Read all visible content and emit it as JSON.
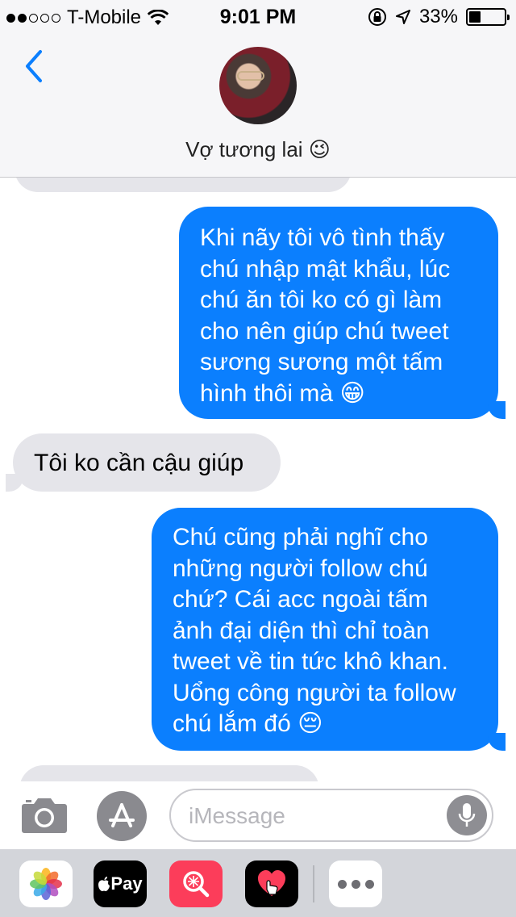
{
  "status_bar": {
    "carrier": "T-Mobile",
    "time": "9:01 PM",
    "battery": "33%",
    "battery_level": 0.33,
    "signal_bars": 2,
    "icons": [
      "wifi-icon",
      "rotation-lock-icon",
      "location-icon",
      "battery-icon"
    ]
  },
  "header": {
    "contact_name": "Vợ tương lai 😉",
    "back_icon": "chevron-left-icon",
    "accent_color": "#0b7ffe"
  },
  "messages": [
    {
      "direction": "incoming",
      "text": ""
    },
    {
      "direction": "outgoing",
      "lines": [
        "Khi nãy tôi vô tình thấy",
        "chú nhập mật khẩu, lúc",
        "chú ăn tôi ko có gì làm",
        "cho nên giúp chú tweet",
        "sương sương một tấm",
        "hình thôi mà 😁"
      ]
    },
    {
      "direction": "incoming",
      "text": "Tôi ko cần cậu giúp"
    },
    {
      "direction": "outgoing",
      "lines": [
        "Chú cũng phải nghĩ cho",
        "những người follow chú",
        "chứ? Cái acc ngoài tấm",
        "ảnh đại diện thì chỉ toàn",
        "tweet về tin tức khô khan.",
        "Uổng công người ta follow",
        "chú lắm đó 😔"
      ]
    },
    {
      "direction": "incoming",
      "text": ""
    }
  ],
  "input_bar": {
    "placeholder": "iMessage",
    "value": "",
    "icons": [
      "camera-icon",
      "app-store-icon",
      "microphone-icon"
    ]
  },
  "app_drawer": {
    "apps": [
      "photos-icon",
      "apple-pay-icon",
      "search-images-icon",
      "digital-touch-icon",
      "more-icon"
    ],
    "apple_pay_label": "Pay"
  }
}
